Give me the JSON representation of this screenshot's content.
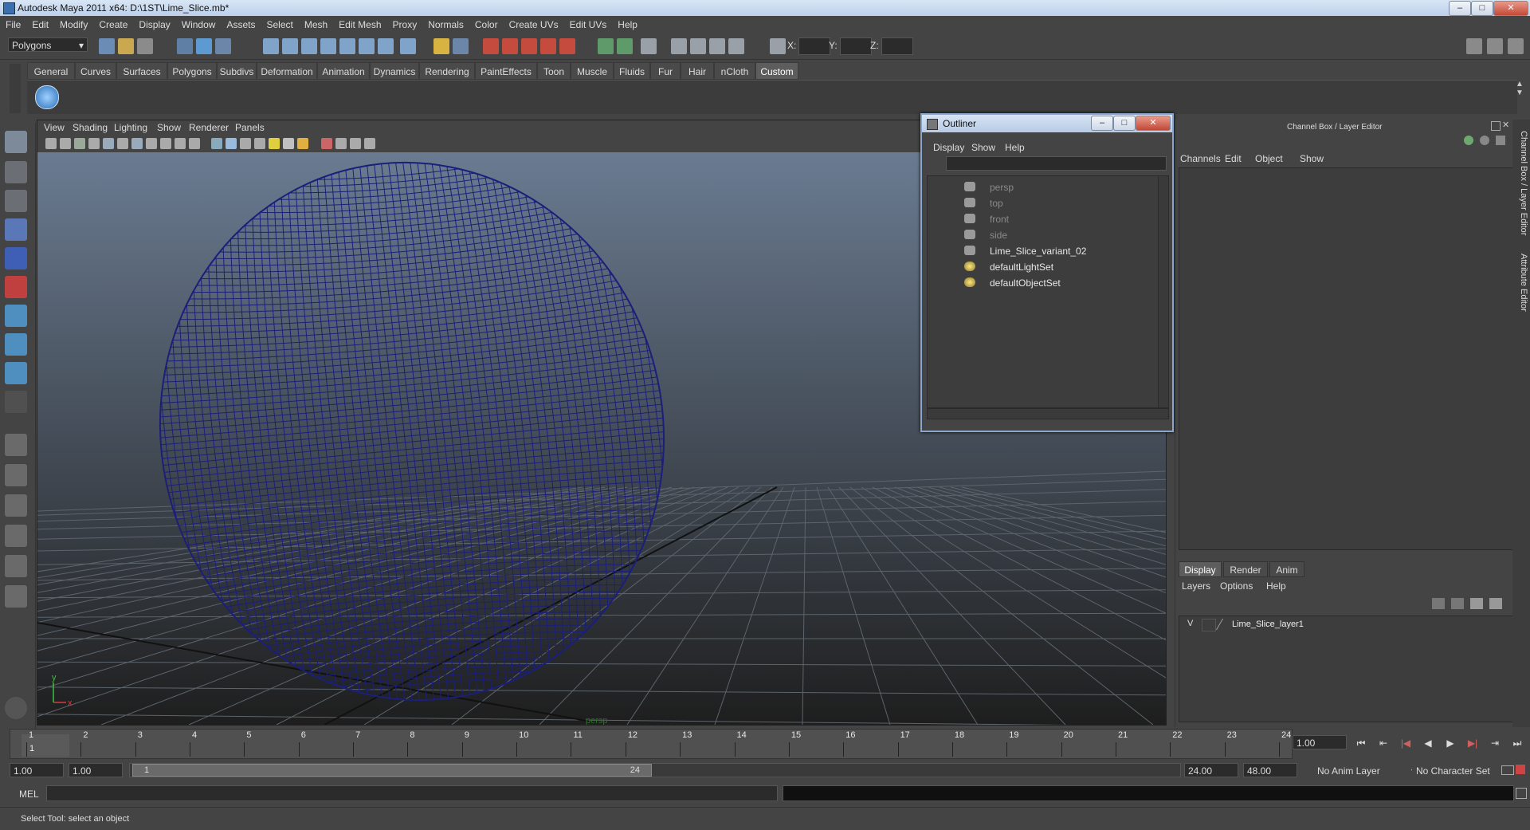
{
  "window": {
    "title": "Autodesk Maya 2011 x64: D:\\1ST\\Lime_Slice.mb*"
  },
  "menubar": [
    "File",
    "Edit",
    "Modify",
    "Create",
    "Display",
    "Window",
    "Assets",
    "Select",
    "Mesh",
    "Edit Mesh",
    "Proxy",
    "Normals",
    "Color",
    "Create UVs",
    "Edit UVs",
    "Help"
  ],
  "statusline": {
    "mode": "Polygons",
    "x_label": "X:",
    "y_label": "Y:",
    "z_label": "Z:"
  },
  "shelf": {
    "tabs": [
      "General",
      "Curves",
      "Surfaces",
      "Polygons",
      "Subdivs",
      "Deformation",
      "Animation",
      "Dynamics",
      "Rendering",
      "PaintEffects",
      "Toon",
      "Muscle",
      "Fluids",
      "Fur",
      "Hair",
      "nCloth",
      "Custom"
    ],
    "active": "Custom"
  },
  "viewport": {
    "menus": [
      "View",
      "Shading",
      "Lighting",
      "Show",
      "Renderer",
      "Panels"
    ],
    "camera_label": "persp",
    "axis_x": "x",
    "axis_y": "y"
  },
  "outliner": {
    "title": "Outliner",
    "menus": [
      "Display",
      "Show",
      "Help"
    ],
    "items": [
      {
        "label": "persp",
        "dim": true,
        "icon": "camera-icon"
      },
      {
        "label": "top",
        "dim": true,
        "icon": "camera-icon"
      },
      {
        "label": "front",
        "dim": true,
        "icon": "camera-icon"
      },
      {
        "label": "side",
        "dim": true,
        "icon": "camera-icon"
      },
      {
        "label": "Lime_Slice_variant_02",
        "dim": false,
        "icon": "transform-icon"
      },
      {
        "label": "defaultLightSet",
        "dim": false,
        "icon": "set-icon"
      },
      {
        "label": "defaultObjectSet",
        "dim": false,
        "icon": "set-icon"
      }
    ]
  },
  "channelbox": {
    "title": "Channel Box / Layer Editor",
    "menus": [
      "Channels",
      "Edit",
      "Object",
      "Show"
    ],
    "layer_tabs": [
      "Display",
      "Render",
      "Anim"
    ],
    "layer_menus": [
      "Layers",
      "Options",
      "Help"
    ],
    "layer": {
      "visible": "V",
      "name": "Lime_Slice_layer1"
    }
  },
  "side_tabs": [
    "Channel Box / Layer Editor",
    "Attribute Editor"
  ],
  "timeline": {
    "ticks": [
      "1",
      "2",
      "3",
      "4",
      "5",
      "6",
      "7",
      "8",
      "9",
      "10",
      "11",
      "12",
      "13",
      "14",
      "15",
      "16",
      "17",
      "18",
      "19",
      "20",
      "21",
      "22",
      "23",
      "24"
    ],
    "current_frame_marker": "1",
    "current_frame": "1.00"
  },
  "range": {
    "start": "1.00",
    "playback_start": "1.00",
    "handle_start": "1",
    "handle_end": "24",
    "playback_end": "24.00",
    "end": "48.00",
    "anim_layer": "No Anim Layer",
    "character_set": "No Character Set"
  },
  "cmdline": {
    "label": "MEL"
  },
  "helpline": {
    "text": "Select Tool: select an object"
  }
}
